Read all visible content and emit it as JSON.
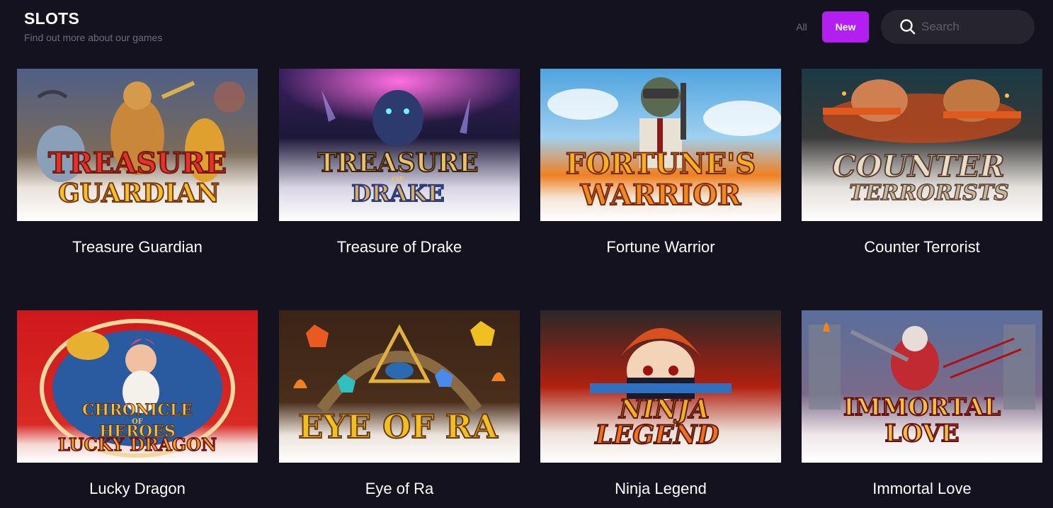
{
  "header": {
    "title": "SLOTS",
    "subtitle": "Find out more about our games"
  },
  "filters": {
    "all_label": "All",
    "new_label": "New",
    "active_color": "#b31ff0"
  },
  "search": {
    "placeholder": "Search",
    "value": ""
  },
  "games": [
    {
      "title": "Treasure Guardian",
      "logo_line1": "TREASURE",
      "logo_line2": "GUARDIAN",
      "bg": "#5a6b8c"
    },
    {
      "title": "Treasure of Drake",
      "logo_line1": "TREASURE",
      "logo_small": "OF",
      "logo_line2": "DRAKE",
      "bg": "#2a1f4a"
    },
    {
      "title": "Fortune Warrior",
      "logo_line1": "FORTUNE'S",
      "logo_line2": "WARRIOR",
      "bg": "#6fb6e8"
    },
    {
      "title": "Counter Terrorist",
      "logo_line1": "COUNTER",
      "logo_line2": "TERRORISTS",
      "bg": "#1f3a40"
    },
    {
      "title": "Lucky Dragon",
      "logo_line1": "CHRONICLE",
      "logo_small": "OF",
      "logo_line2": "HEROES",
      "logo_line3": "LUCKY DRAGON",
      "bg": "#c8191e"
    },
    {
      "title": "Eye of Ra",
      "logo_line1": "EYE OF RA",
      "bg": "#3a2418"
    },
    {
      "title": "Ninja Legend",
      "logo_line1": "NINJA",
      "logo_line2": "LEGEND",
      "bg": "#2a2626"
    },
    {
      "title": "Immortal Love",
      "logo_line1": "IMMORTAL",
      "logo_line2": "LOVE",
      "bg": "#6b7fa6"
    }
  ]
}
